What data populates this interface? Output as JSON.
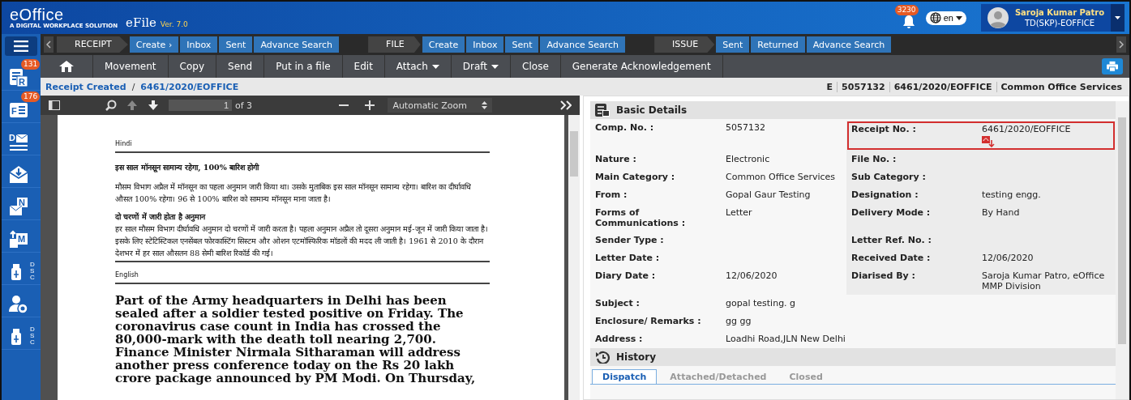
{
  "header": {
    "logo": "eOffice",
    "tagline": "A DIGITAL WORKPLACE SOLUTION",
    "app": "eFile",
    "version": "Ver. 7.0",
    "notifications": "3230",
    "language": "en",
    "user_name": "Saroja Kumar Patro",
    "user_role": "TD(SKP)-EOFFICE"
  },
  "nav_groups": [
    {
      "title": "RECEIPT",
      "links": [
        {
          "label": "Create ›"
        },
        {
          "label": "Inbox"
        },
        {
          "label": "Sent"
        },
        {
          "label": "Advance Search"
        }
      ]
    },
    {
      "title": "FILE",
      "links": [
        {
          "label": "Create"
        },
        {
          "label": "Inbox"
        },
        {
          "label": "Sent"
        },
        {
          "label": "Advance Search"
        }
      ]
    },
    {
      "title": "ISSUE",
      "links": [
        {
          "label": "Sent"
        },
        {
          "label": "Returned"
        },
        {
          "label": "Advance Search"
        }
      ]
    }
  ],
  "sidebar": [
    {
      "kind": "receipt",
      "letter": "R",
      "badge": "131"
    },
    {
      "kind": "file",
      "letter": "F",
      "badge": "176"
    },
    {
      "kind": "dak",
      "letter": "D"
    },
    {
      "kind": "inbox"
    },
    {
      "kind": "notice",
      "letter": "N"
    },
    {
      "kind": "movement",
      "letter": "M"
    },
    {
      "kind": "dsc",
      "letter": "DSC"
    },
    {
      "kind": "user-settings"
    },
    {
      "kind": "dsc",
      "letter": "DSC"
    }
  ],
  "toolbar": [
    {
      "label": "Movement",
      "dropdown": false
    },
    {
      "label": "Copy",
      "dropdown": false
    },
    {
      "label": "Send",
      "dropdown": false
    },
    {
      "label": "Put in a file",
      "dropdown": false
    },
    {
      "label": "Edit",
      "dropdown": false
    },
    {
      "label": "Attach",
      "dropdown": true
    },
    {
      "label": "Draft",
      "dropdown": true
    },
    {
      "label": "Close",
      "dropdown": false
    },
    {
      "label": "Generate Acknowledgement",
      "dropdown": false
    }
  ],
  "breadcrumb": {
    "items": [
      "Receipt Created",
      "6461/2020/EOFFICE"
    ],
    "separator": "/"
  },
  "info": [
    "E",
    "5057132",
    "6461/2020/EOFFICE",
    "Common Office Services"
  ],
  "viewer": {
    "page": "1",
    "page_count": "of 3",
    "zoom": "Automatic Zoom",
    "document": [
      {
        "kind": "section",
        "text": "Hindi"
      },
      {
        "kind": "heading",
        "text": "इस साल मॉनसून सामान्य रहेगा, 100% बारिश होगी"
      },
      {
        "kind": "para",
        "text": "मौसम विभाग अप्रैल में मॉनसून का पहला अनुमान जारी किया था। उसके मुताबिक इस साल मॉनसून सामान्य रहेगा। बारिश का दीर्घावधि औसत 100% रहेगा। 96 से 100% बारिश को सामान्य मॉनसून माना जाता है।"
      },
      {
        "kind": "subheading",
        "text": "दो चरणों में जारी होता है अनुमान"
      },
      {
        "kind": "para",
        "text": "हर साल मौसम विभाग दीर्घावधि अनुमान दो चरणों में जारी करता है। पहला अनुमान अप्रैल तो दूसरा अनुमान मई-जून में जारी किया जाता है। इसके लिए स्टेटिस्टिकल एनसेंबल फोरकास्टिंग सिस्टम और ओशन एटमॉस्फिरिक मॉडलों की मदद ली जाती है। 1961 से 2010 के दौरान देशभर में हर साल औसतन 88 सेमी बारिश रिकॉर्ड की गई।"
      },
      {
        "kind": "section",
        "text": "English"
      },
      {
        "kind": "lead",
        "text": "Part of the Army headquarters in Delhi has been sealed after a soldier tested positive on Friday. The coronavirus case count in India has crossed the 80,000-mark with the death toll nearing 2,700. Finance Minister Nirmala Sitharaman will address another press conference today on the Rs 20 lakh crore package announced by PM Modi. On Thursday,"
      }
    ]
  },
  "details": {
    "title": "Basic Details",
    "rows": [
      {
        "left": {
          "label": "Comp. No. :",
          "value": "5057132"
        },
        "right": {
          "label": "Receipt No. :",
          "value": "6461/2020/EOFFICE",
          "attachment": true,
          "highlighted": true
        }
      },
      {
        "left": {
          "label": "Nature :",
          "value": "Electronic"
        },
        "right": {
          "label": "File No. :",
          "attachment": false,
          "highlighted": false
        }
      },
      {
        "left": {
          "label": "Main Category :",
          "value": "Common Office Services"
        },
        "right": {
          "label": "Sub Category :",
          "attachment": false,
          "highlighted": false
        }
      },
      {
        "left": {
          "label": "From :",
          "value": "Gopal Gaur Testing"
        },
        "right": {
          "label": "Designation :",
          "value": "testing  engg.",
          "attachment": false,
          "highlighted": false
        }
      },
      {
        "left": {
          "label": "Forms of Communications :",
          "value": "Letter"
        },
        "right": {
          "label": "Delivery Mode :",
          "value": "By Hand",
          "attachment": false,
          "highlighted": false
        }
      },
      {
        "left": {
          "label": "Sender Type :"
        },
        "right": {
          "label": "Letter Ref. No. :",
          "attachment": false,
          "highlighted": false
        }
      },
      {
        "left": {
          "label": "Letter Date :"
        },
        "right": {
          "label": "Received Date :",
          "value": "12/06/2020",
          "attachment": false,
          "highlighted": false
        }
      },
      {
        "left": {
          "label": "Diary Date :",
          "value": "12/06/2020"
        },
        "right": {
          "label": "Diarised By :",
          "value": "Saroja Kumar Patro, eOffice MMP Division",
          "attachment": false,
          "highlighted": false
        }
      }
    ],
    "wide_rows": [
      {
        "label": "Subject :",
        "value": "gopal testing. g"
      },
      {
        "label": "Enclosure/ Remarks :",
        "value": "gg gg"
      },
      {
        "label": "Address :",
        "value": "Loadhi Road,JLN New Delhi"
      }
    ]
  },
  "history": {
    "title": "History",
    "tabs": [
      {
        "label": "Dispatch",
        "selected": true
      },
      {
        "label": "Attached/Detached",
        "selected": false
      },
      {
        "label": "Closed",
        "selected": false
      }
    ]
  }
}
